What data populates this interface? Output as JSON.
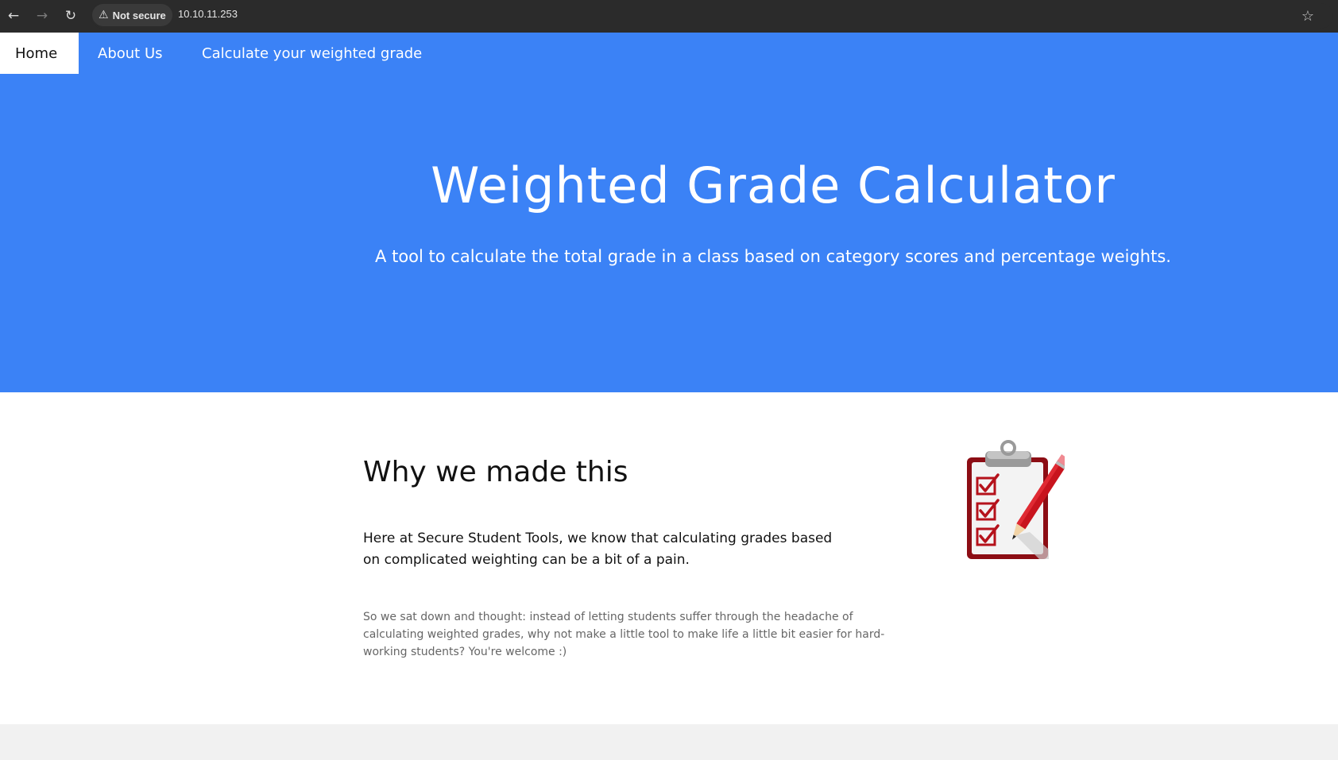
{
  "browser": {
    "back_icon": "arrow-left-icon",
    "forward_icon": "arrow-right-icon",
    "reload_icon": "reload-icon",
    "security_label": "Not secure",
    "url": "10.10.11.253",
    "bookmark_icon": "star-icon"
  },
  "nav": {
    "items": [
      {
        "label": "Home",
        "active": true
      },
      {
        "label": "About Us",
        "active": false
      },
      {
        "label": "Calculate your weighted grade",
        "active": false
      }
    ]
  },
  "hero": {
    "title": "Weighted Grade Calculator",
    "subtitle": "A tool to calculate the total grade in a class based on category scores and percentage weights."
  },
  "about": {
    "heading": "Why we made this",
    "lead": "Here at Secure Student Tools, we know that calculating grades based on complicated weighting can be a bit of a pain.",
    "body": "So we sat down and thought: instead of letting students suffer through the headache of calculating weighted grades, why not make a little tool to make life a little bit easier for hard-working students? You're welcome :)",
    "illustration": "clipboard-checklist-icon"
  },
  "colors": {
    "brand_blue": "#3b82f6",
    "checkmark_red": "#b5121b"
  }
}
